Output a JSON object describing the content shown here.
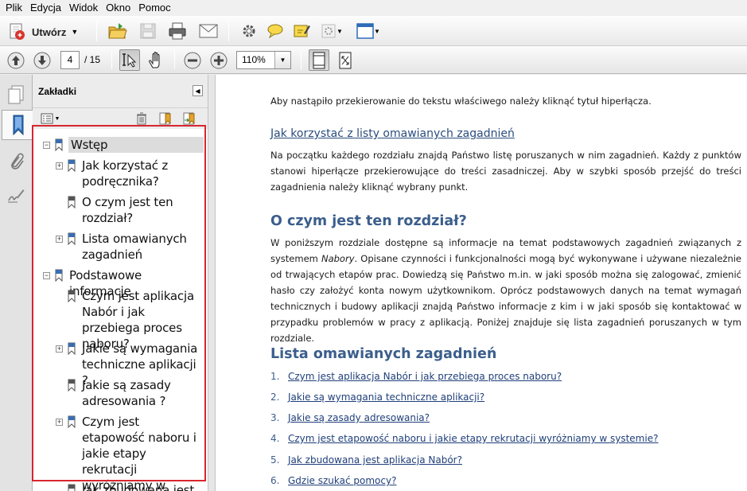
{
  "menu": [
    "Plik",
    "Edycja",
    "Widok",
    "Okno",
    "Pomoc"
  ],
  "toolbar": {
    "create_label": "Utwórz",
    "page_current": "4",
    "page_total": "/ 15",
    "zoom": "110%"
  },
  "bookmarks_panel": {
    "title": "Zakładki",
    "items": [
      {
        "label": "Wstęp"
      },
      {
        "label": "Jak korzystać z podręcznika?"
      },
      {
        "label": "O czym jest ten rozdział?"
      },
      {
        "label": "Lista omawianych zagadnień"
      },
      {
        "label": "Podstawowe informacje"
      },
      {
        "label": "Czym jest aplikacja Nabór i jak przebiega proces naboru?"
      },
      {
        "label": "Jakie są wymagania techniczne aplikacji ?"
      },
      {
        "label": "Jakie są zasady adresowania ?"
      },
      {
        "label": "Czym jest etapowość naboru i jakie etapy rekrutacji wyróżniamy w systemie?"
      },
      {
        "label": "Jak zbudowana jest"
      }
    ]
  },
  "document": {
    "intro": "Aby nastąpiło przekierowanie do tekstu właściwego należy kliknąć tytuł hiperłącza.",
    "link_heading": "Jak korzystać z listy omawianych zagadnień",
    "link_par": "Na początku każdego rozdziału znajdą Państwo listę poruszanych w nim zagadnień. Każdy z punktów stanowi hiperłącze przekierowujące do treści zasadniczej. Aby w szybki sposób przejść do treści zagadnienia należy kliknąć wybrany punkt.",
    "h2_about": "O czym jest ten rozdział?",
    "about_par_1": "W poniższym rozdziale dostępne są informacje na temat podstawowych zagadnień związanych z systemem",
    "about_italic": "Nabory",
    "about_par_2": ". Opisane czynności i funkcjonalności mogą być wykonywane i używane niezależnie od trwających etapów prac. Dowiedzą się Państwo m.in. w jaki sposób można się zalogować, zmienić hasło czy założyć konta nowym użytkownikom. Oprócz podstawowych danych na temat wymagań technicznych i budowy aplikacji znajdą Państwo informacje z kim i w jaki sposób się kontaktować w przypadku problemów w pracy z aplikacją. Poniżej znajduje się lista zagadnień poruszanych w tym rozdziale.",
    "h2_list": "Lista omawianych zagadnień",
    "list": [
      {
        "n": "1.",
        "t": "Czym jest aplikacja Nabór i jak przebiega proces naboru?"
      },
      {
        "n": "2.",
        "t": "Jakie są wymagania techniczne aplikacji?"
      },
      {
        "n": "3.",
        "t": "Jakie są zasady adresowania?"
      },
      {
        "n": "4.",
        "t": "Czym jest etapowość naboru i jakie etapy rekrutacji wyróżniamy w systemie?"
      },
      {
        "n": "5.",
        "t": "Jak zbudowana jest aplikacja Nabór?"
      },
      {
        "n": "6.",
        "t": "Gdzie szukać pomocy?"
      }
    ]
  }
}
